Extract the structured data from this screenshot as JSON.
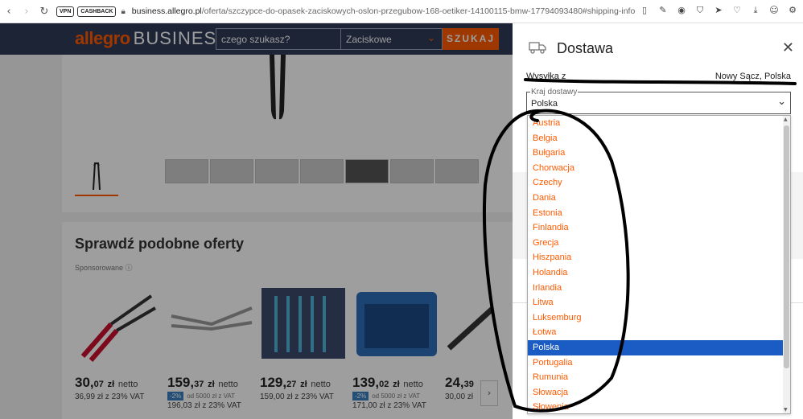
{
  "browser": {
    "back_icon": "‹",
    "forward_icon": "›",
    "reload_icon": "↻",
    "vpn_badge": "VPN",
    "cashback_badge": "CASHBACK",
    "url_domain": "business.allegro.pl",
    "url_path": "/oferta/szczypce-do-opasek-zaciskowych-oslon-przegubow-168-oetiker-14100115-bmw-17794093480#shipping-info"
  },
  "site": {
    "logo_main": "allegro",
    "logo_suffix": "BUSINESS",
    "search_placeholder": "czego szukasz?",
    "search_category": "Zaciskowe",
    "search_button": "SZUKAJ"
  },
  "background_page": {
    "similar_title": "Sprawdź podobne oferty",
    "sponsored": "Sponsorowane ⓘ",
    "products": [
      {
        "price_int": "30,",
        "price_dec": "07",
        "currency": "zł",
        "net": "netto",
        "gross": "36,99 zł z 23% VAT",
        "discount": "",
        "discount_note": ""
      },
      {
        "price_int": "159,",
        "price_dec": "37",
        "currency": "zł",
        "net": "netto",
        "gross": "196,03 zł z 23% VAT",
        "discount": "-2%",
        "discount_note": "od 5000 zł z VAT"
      },
      {
        "price_int": "129,",
        "price_dec": "27",
        "currency": "zł",
        "net": "netto",
        "gross": "159,00 zł z 23% VAT",
        "discount": "",
        "discount_note": ""
      },
      {
        "price_int": "139,",
        "price_dec": "02",
        "currency": "zł",
        "net": "netto",
        "gross": "171,00 zł z 23% VAT",
        "discount": "-2%",
        "discount_note": "od 5000 zł z VAT"
      },
      {
        "price_int": "24,",
        "price_dec": "39",
        "currency": "",
        "net": "",
        "gross": "30,00 zł",
        "discount": "",
        "discount_note": ""
      }
    ]
  },
  "panel": {
    "title": "Dostawa",
    "close_icon": "✕",
    "ship_from_label": "Wysyłka z",
    "ship_from_value": "Nowy Sącz, Polska",
    "country_legend": "Kraj dostawy",
    "country_value": "Polska",
    "chevron": "⌄"
  },
  "dropdown": {
    "options": [
      "Austria",
      "Belgia",
      "Bułgaria",
      "Chorwacja",
      "Czechy",
      "Dania",
      "Estonia",
      "Finlandia",
      "Grecja",
      "Hiszpania",
      "Holandia",
      "Irlandia",
      "Litwa",
      "Luksemburg",
      "Łotwa",
      "Polska",
      "Portugalia",
      "Rumunia",
      "Słowacja",
      "Słowenia"
    ],
    "selected": "Polska"
  },
  "colors": {
    "brand_orange": "#ff5a00",
    "header_navy": "#2e3a57",
    "selected_blue": "#1a5bc4"
  }
}
